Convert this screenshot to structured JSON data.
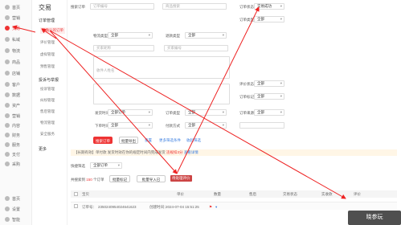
{
  "rail": [
    {
      "label": "首页",
      "active": false
    },
    {
      "label": "营销",
      "active": false
    },
    {
      "label": "交易",
      "active": true
    },
    {
      "label": "私域",
      "active": false
    },
    {
      "label": "物流",
      "active": false
    },
    {
      "label": "商品",
      "active": false
    },
    {
      "label": "店铺",
      "active": false
    },
    {
      "label": "客户",
      "active": false
    },
    {
      "label": "数据",
      "active": false
    },
    {
      "label": "资产",
      "active": false
    },
    {
      "label": "营销",
      "active": false
    },
    {
      "label": "内容",
      "active": false
    },
    {
      "label": "财务",
      "active": false
    },
    {
      "label": "服务",
      "active": false
    },
    {
      "label": "支付",
      "active": false
    },
    {
      "label": "采购",
      "active": false
    }
  ],
  "rail_bottom": [
    {
      "label": "首页"
    },
    {
      "label": "设置"
    },
    {
      "label": "智能"
    }
  ],
  "subnav": {
    "title": "交易",
    "group1": "订单管理",
    "items1": [
      "已确认的订单",
      "评价管理",
      "虚拟管理",
      "预售管理"
    ],
    "group2": "投诉与举报",
    "items2": [
      "投诉管理",
      "纠纷管理",
      "售后管理",
      "物流管理",
      "安全服务"
    ],
    "more": "更多"
  },
  "filters": {
    "row1": [
      {
        "label": "搜索订单",
        "placeholder": "订单编号"
      },
      {
        "label": "",
        "placeholder": "商品搜索"
      },
      {
        "label": "订单状态",
        "value": "交易成功"
      }
    ],
    "order_type_label": "订单类型",
    "order_type_value": "全部",
    "row2_label": "物流类型",
    "row2_value": "全部",
    "row2b_label": "退款类型",
    "row2b_value": "全部",
    "row3_placeholder": "买家昵称",
    "row3b_placeholder": "买家编号",
    "row4_placeholder": "收件人姓名",
    "row5_label": "评价状态",
    "row5_value": "全部",
    "row6_label": "订单标记",
    "row6_value": "全部",
    "row7_label": "付款方式",
    "row7_value": "全部",
    "row8_label": "订单类型",
    "row8_value": "全部",
    "row9_label": "订单来源",
    "row9_value": "全部",
    "row10_label": "发货时间",
    "row10_value": "全部订单",
    "time_label": "下单时间",
    "time_value": "全部",
    "search_btn": "搜索订单",
    "export_btn": "批量导出",
    "reset_link": "重置",
    "more_link": "更多筛选条件",
    "collapse_link": "收起筛选"
  },
  "notice": {
    "prefix": "【长期有效】单付款",
    "mid": "发货时效在你的规定时间内完成发货",
    "warn": "违规扣3分",
    "link": "查看详情"
  },
  "bulk": {
    "label": "快捷筛选",
    "select_value": "全部订单",
    "count_prefix": "共搜索到",
    "count": "150",
    "count_suffix": "个订单",
    "mark_btn": "批量标记",
    "import_btn": "批量导入已",
    "highlight_btn": "待处理评价"
  },
  "table": {
    "headers": [
      "宝贝",
      "单价",
      "数量",
      "售后",
      "交易状态",
      "实收款",
      "评价"
    ],
    "row": {
      "order_no": "订单号：",
      "order_no_value": "2350240954024641623",
      "created_label": "创建时间：",
      "created_value": "2024-07-04 15:51:25",
      "flag_icon": "flag-icon"
    }
  },
  "watermark": "晓参玩"
}
